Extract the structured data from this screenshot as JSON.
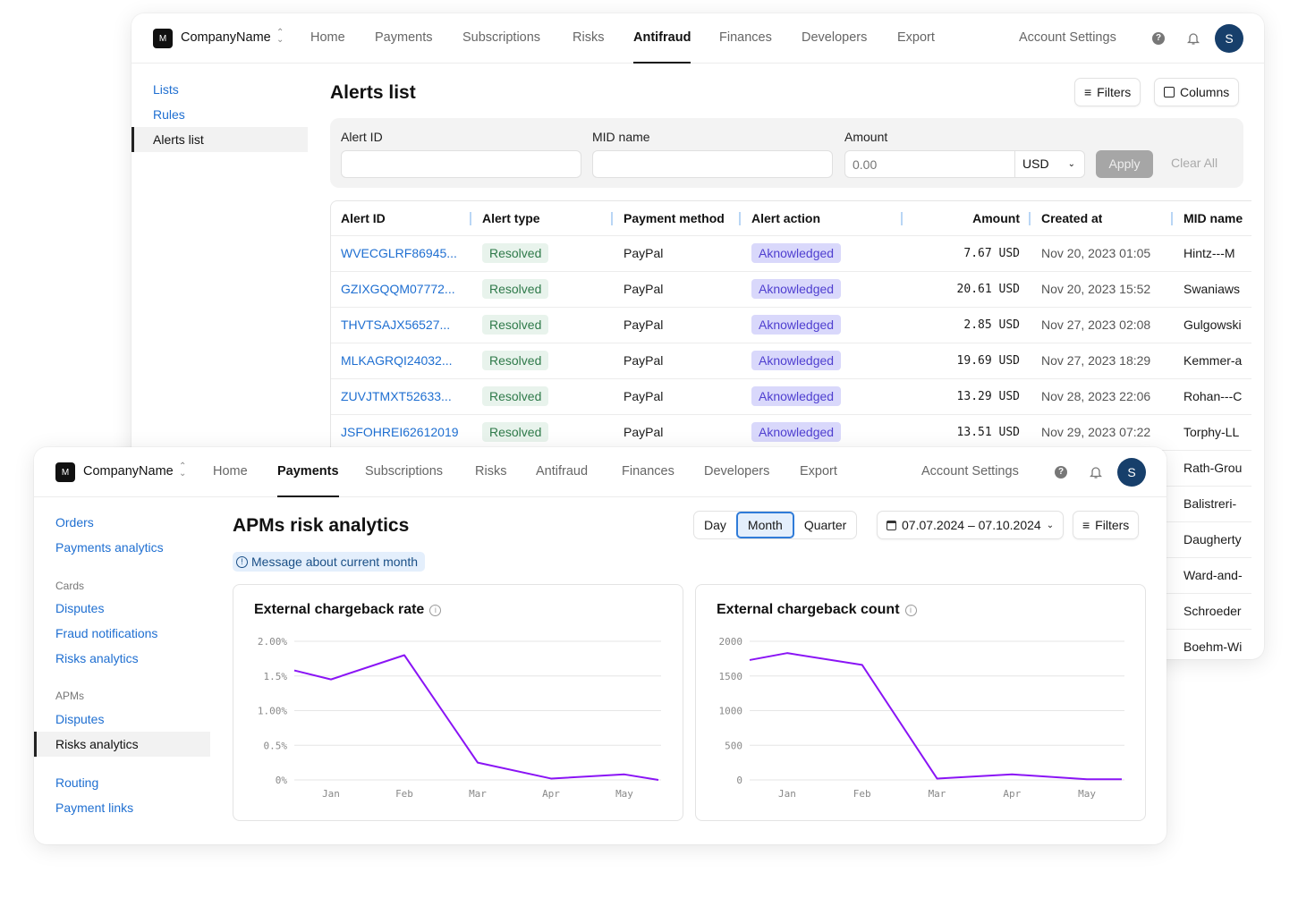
{
  "back_window": {
    "nav": {
      "logo_letter": "M",
      "company": "CompanyName",
      "items": [
        "Home",
        "Payments",
        "Subscriptions",
        "Risks",
        "Antifraud",
        "Finances",
        "Developers",
        "Export"
      ],
      "active": "Antifraud",
      "account_settings": "Account Settings",
      "avatar_letter": "S"
    },
    "sidebar": {
      "items": [
        "Lists",
        "Rules",
        "Alerts list"
      ],
      "active": "Alerts list"
    },
    "title": "Alerts list",
    "filters_button": "Filters",
    "columns_button": "Columns",
    "filter_bar": {
      "alert_id_label": "Alert ID",
      "alert_id_value": "",
      "mid_name_label": "MID name",
      "mid_name_value": "",
      "amount_label": "Amount",
      "amount_placeholder": "0.00",
      "currency": "USD",
      "apply": "Apply",
      "clear_all": "Clear All"
    },
    "table": {
      "columns": [
        "Alert ID",
        "Alert type",
        "Payment method",
        "Alert action",
        "Amount",
        "Created at",
        "MID name"
      ],
      "rows": [
        {
          "id": "WVECGLRF86945...",
          "type": "Resolved",
          "method": "PayPal",
          "action": "Aknowledged",
          "amount": "7.67 USD",
          "created": "Nov 20, 2023 01:05",
          "mid": "Hintz---M"
        },
        {
          "id": "GZIXGQQM07772...",
          "type": "Resolved",
          "method": "PayPal",
          "action": "Aknowledged",
          "amount": "20.61 USD",
          "created": "Nov 20, 2023 15:52",
          "mid": "Swaniaws"
        },
        {
          "id": "THVTSAJX56527...",
          "type": "Resolved",
          "method": "PayPal",
          "action": "Aknowledged",
          "amount": "2.85 USD",
          "created": "Nov 27, 2023 02:08",
          "mid": "Gulgowski"
        },
        {
          "id": "MLKAGRQI24032...",
          "type": "Resolved",
          "method": "PayPal",
          "action": "Aknowledged",
          "amount": "19.69 USD",
          "created": "Nov 27, 2023 18:29",
          "mid": "Kemmer-a"
        },
        {
          "id": "ZUVJTMXT52633...",
          "type": "Resolved",
          "method": "PayPal",
          "action": "Aknowledged",
          "amount": "13.29 USD",
          "created": "Nov 28, 2023 22:06",
          "mid": "Rohan---C"
        },
        {
          "id": "JSFOHREI62612019",
          "type": "Resolved",
          "method": "PayPal",
          "action": "Aknowledged",
          "amount": "13.51 USD",
          "created": "Nov 29, 2023 07:22",
          "mid": "Torphy-LL"
        },
        {
          "mid": "Rath-Grou"
        },
        {
          "mid": "Balistreri-"
        },
        {
          "mid": "Daugherty"
        },
        {
          "mid": "Ward-and-"
        },
        {
          "mid": "Schroeder"
        },
        {
          "mid": "Boehm-Wi"
        }
      ]
    }
  },
  "front_window": {
    "nav": {
      "logo_letter": "M",
      "company": "CompanyName",
      "items": [
        "Home",
        "Payments",
        "Subscriptions",
        "Risks",
        "Antifraud",
        "Finances",
        "Developers",
        "Export"
      ],
      "active": "Payments",
      "account_settings": "Account Settings",
      "avatar_letter": "S"
    },
    "sidebar": {
      "orders": "Orders",
      "payments_analytics": "Payments analytics",
      "cards_group": "Cards",
      "cards_disputes": "Disputes",
      "fraud_notifications": "Fraud notifications",
      "cards_risks": "Risks analytics",
      "apms_group": "APMs",
      "apms_disputes": "Disputes",
      "apms_risks": "Risks analytics",
      "routing": "Routing",
      "payment_links": "Payment links",
      "active": "APMs / Risks analytics"
    },
    "title": "APMs risk analytics",
    "period": {
      "options": [
        "Day",
        "Month",
        "Quarter"
      ],
      "selected": "Month"
    },
    "date_range": "07.07.2024 – 07.10.2024",
    "filters_button": "Filters",
    "message": "Message about current month"
  },
  "colors": {
    "line": "#8a14f5",
    "link": "#1f6fd1",
    "avatar": "#173f6b"
  },
  "chart_data": [
    {
      "type": "line",
      "title": "External chargeback rate",
      "categories": [
        "Jan",
        "Feb",
        "Mar",
        "Apr",
        "May"
      ],
      "values": [
        1.45,
        1.8,
        0.25,
        0.02,
        0.08
      ],
      "edge_values": [
        1.58,
        0.0
      ],
      "unit": "%",
      "yticks": [
        "0%",
        "0.5%",
        "1.00%",
        "1.5%",
        "2.00%"
      ],
      "ylim": [
        0,
        2
      ],
      "grid": true,
      "color": "#8a14f5"
    },
    {
      "type": "line",
      "title": "External chargeback count",
      "categories": [
        "Jan",
        "Feb",
        "Mar",
        "Apr",
        "May"
      ],
      "values": [
        1830,
        1660,
        20,
        80,
        10
      ],
      "edge_values": [
        1730,
        10
      ],
      "yticks": [
        "0",
        "500",
        "1000",
        "1500",
        "2000"
      ],
      "ylim": [
        0,
        2000
      ],
      "grid": true,
      "color": "#8a14f5"
    }
  ]
}
